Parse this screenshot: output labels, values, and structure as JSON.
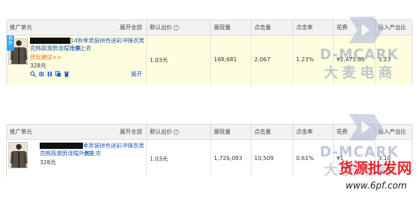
{
  "table1": {
    "headers": {
      "unit": "推广单元",
      "expand_all": "展开全部",
      "default_bid": "默认出价",
      "impressions": "展现量",
      "clicks": "点击量",
      "ctr": "点击率",
      "spend": "花费",
      "roi": "投入产出比"
    },
    "row": {
      "tag": "推荐",
      "title_line1": "14秋季男装拼色迷彩冲锋衣男士夹",
      "title_line2": "克韩版潮男连帽外套上衣",
      "suggestion": "优化建议>>",
      "price": "328元",
      "expand": "展开",
      "default_bid": "1.03元",
      "impressions": "168,681",
      "clicks": "2,067",
      "ctr": "1.23%",
      "spend": "¥2,475.86",
      "roi": "3.23"
    }
  },
  "table2": {
    "headers": {
      "unit": "推广单元",
      "expand_all": "展开全部",
      "default_bid": "默认出价",
      "impressions": "展现量",
      "clicks": "点击量",
      "ctr": "点击率",
      "spend": "花费",
      "roi": "投入产出比"
    },
    "row": {
      "title_line1": "季男装拼色迷彩冲锋衣男士夹",
      "title_line2": "克韩版潮男连帽外套上衣",
      "price": "328元",
      "default_bid": "1.03元",
      "impressions": "1,726,083",
      "clicks": "10,509",
      "ctr": "0.61%",
      "spend": "¥1",
      "roi": "3.10"
    }
  },
  "watermarks": {
    "brand_en": "D-MCARK",
    "brand_cn": "大麦电商",
    "site_cn": "货源批发网",
    "site_url": "www.6pf.com"
  },
  "colors": {
    "link": "#1f57c3",
    "suggestion": "#ff6a00",
    "header_bg": "#f2f2f2",
    "highlight_row": "#fdfde0",
    "tag_bg": "#2ea7f7",
    "watermark": "#8f9bb8",
    "site_watermark": "#e2252b"
  }
}
